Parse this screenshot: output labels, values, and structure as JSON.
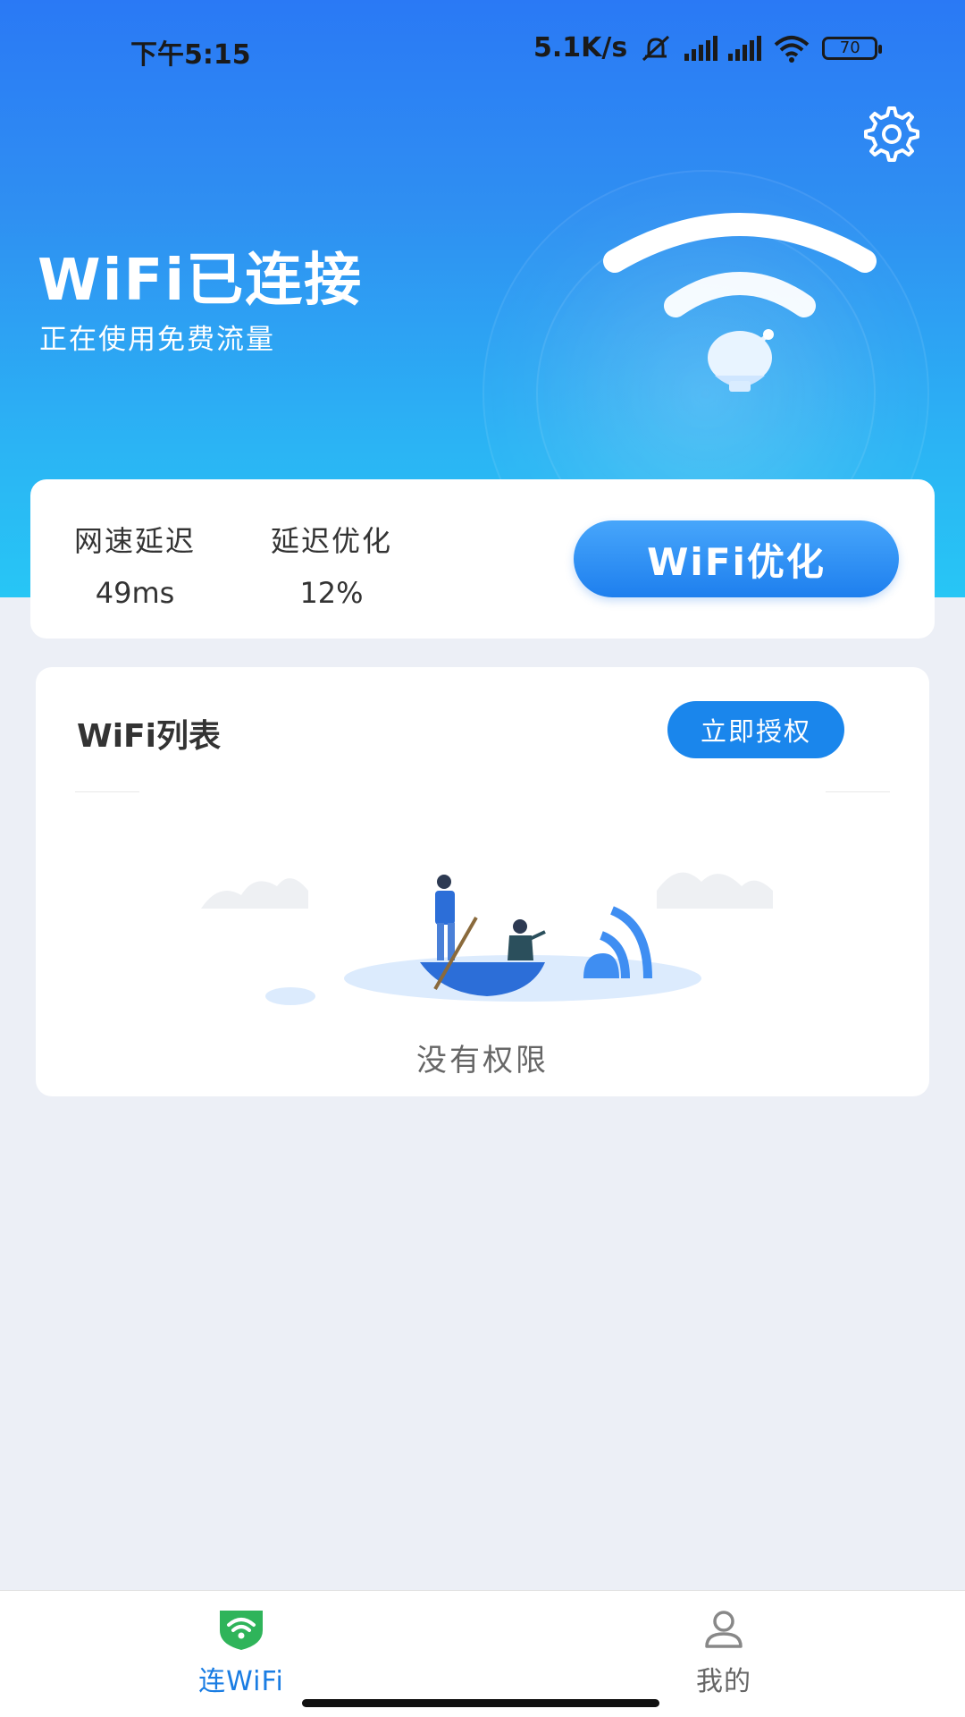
{
  "status_bar": {
    "time": "下午5:15",
    "net_speed": "5.1K/s",
    "battery": "70"
  },
  "hero": {
    "title": "WiFi已连接",
    "subtitle": "正在使用免费流量"
  },
  "stats": {
    "items": [
      {
        "label": "网速延迟",
        "value": "49ms"
      },
      {
        "label": "延迟优化",
        "value": "12%"
      }
    ],
    "optimize_button": "WiFi优化"
  },
  "wifi_list": {
    "title": "WiFi列表",
    "authorize_button": "立即授权",
    "empty_text": "没有权限"
  },
  "tabbar": {
    "tabs": [
      {
        "label": "连WiFi",
        "icon": "shield-wifi-icon",
        "active": true
      },
      {
        "label": "我的",
        "icon": "user-icon",
        "active": false
      }
    ]
  },
  "colors": {
    "accent": "#1a86ec",
    "active_tab": "#1a7de3",
    "inactive_tab": "#666666",
    "shield_green": "#2fb45a"
  }
}
